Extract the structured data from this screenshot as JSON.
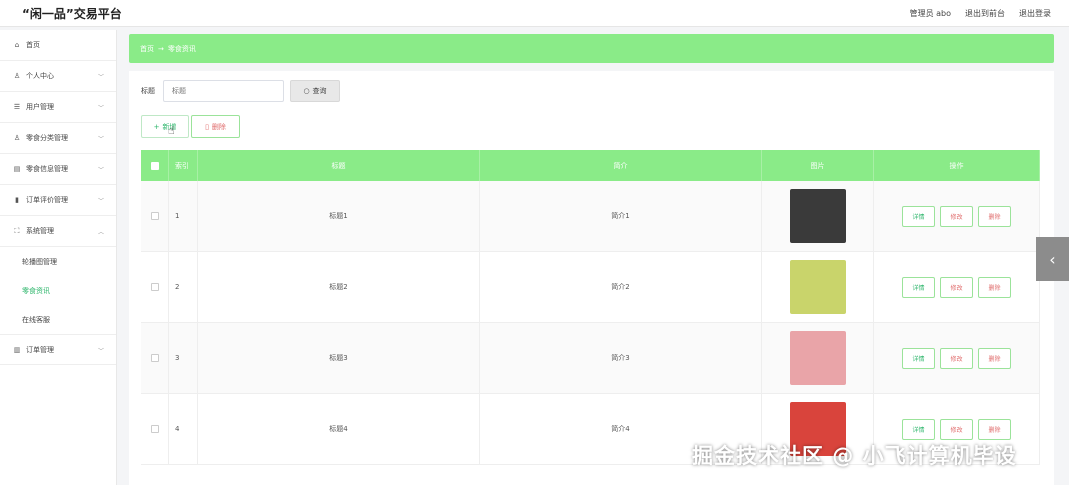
{
  "header": {
    "brand": "“闲一品”交易平台",
    "user": "管理员 abo",
    "back_front": "退出到前台",
    "logout": "退出登录"
  },
  "sidebar": {
    "items": [
      {
        "label": "首页",
        "icon": "home-icon"
      },
      {
        "label": "个人中心",
        "icon": "person-icon"
      },
      {
        "label": "用户管理",
        "icon": "list-icon"
      },
      {
        "label": "零食分类管理",
        "icon": "person-icon"
      },
      {
        "label": "零食信息管理",
        "icon": "printer-icon"
      },
      {
        "label": "订单评价管理",
        "icon": "bar-chart-icon"
      },
      {
        "label": "系统管理",
        "icon": "frame-icon"
      }
    ],
    "sub_items": [
      {
        "label": "轮播图管理"
      },
      {
        "label": "零食资讯"
      },
      {
        "label": "在线客服"
      }
    ],
    "last_item": {
      "label": "订单管理",
      "icon": "trash-icon"
    }
  },
  "breadcrumb": {
    "home": "首页",
    "arrow": "→",
    "current": "零食资讯"
  },
  "search": {
    "label": "标题",
    "placeholder": "标题",
    "button": "查询"
  },
  "actions": {
    "add": "新增",
    "delete": "删除"
  },
  "table": {
    "headers": {
      "index": "索引",
      "title": "标题",
      "intro": "简介",
      "image": "图片",
      "ops": "操作"
    },
    "ops": {
      "detail": "详情",
      "edit": "修改",
      "remove": "删除"
    },
    "rows": [
      {
        "index": "1",
        "title": "标题1",
        "intro": "简介1",
        "thumb_color": "#3a3a3a"
      },
      {
        "index": "2",
        "title": "标题2",
        "intro": "简介2",
        "thumb_color": "#c9d46b"
      },
      {
        "index": "3",
        "title": "标题3",
        "intro": "简介3",
        "thumb_color": "#e9a4a8"
      },
      {
        "index": "4",
        "title": "标题4",
        "intro": "简介4",
        "thumb_color": "#d9443c"
      }
    ]
  },
  "side_tab": "‹",
  "watermark": "掘金技术社区 @ 小飞计算机毕设",
  "colors": {
    "accent_green": "#8aeb88",
    "op_green": "#2bb56a",
    "op_red": "#e06c6c"
  }
}
